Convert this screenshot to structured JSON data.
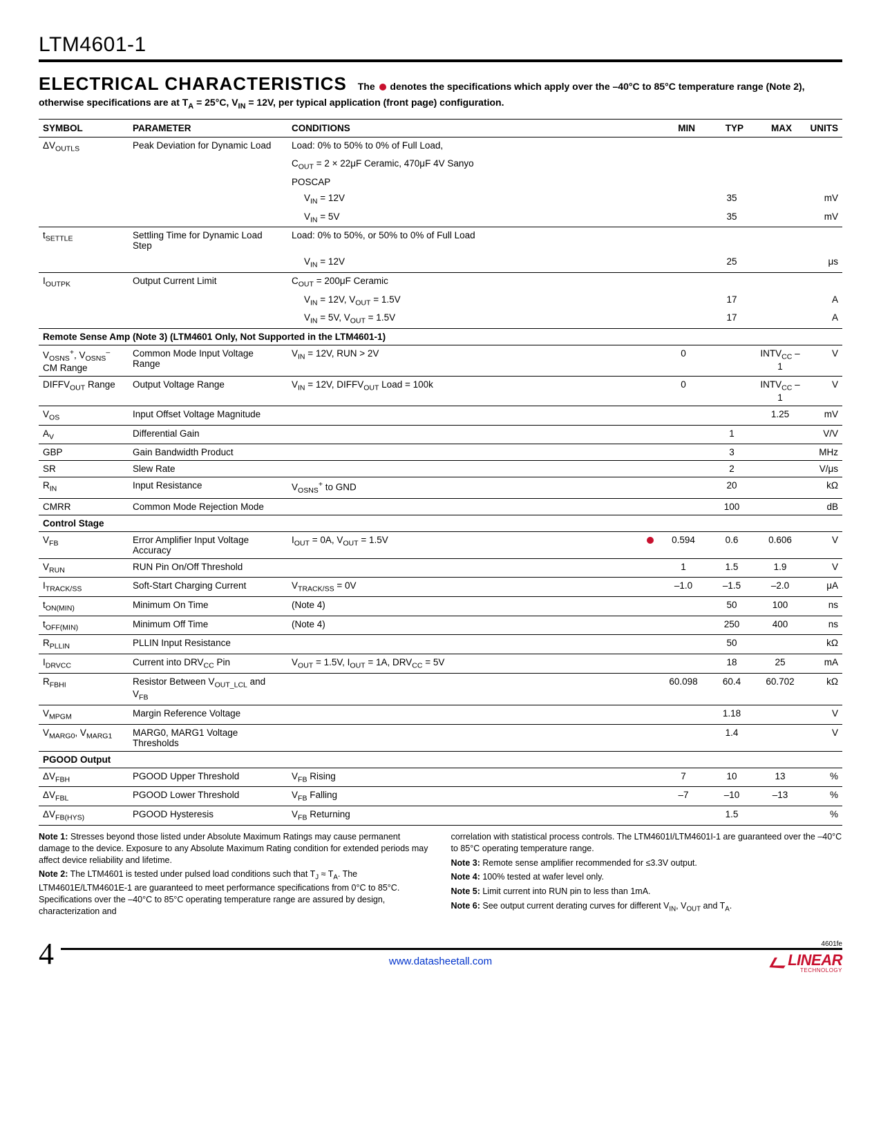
{
  "partNumber": "LTM4601-1",
  "section": {
    "title": "ELECTRICAL CHARACTERISTICS",
    "desc_pre": "The",
    "desc_post": "denotes the specifications which apply over the –40°C to 85°C temperature range (Note 2), otherwise specifications are at T",
    "desc_sub": "A",
    "desc_post2": " = 25°C, V",
    "desc_sub2": "IN",
    "desc_post3": " = 12V, per typical application (front page) configuration."
  },
  "headers": {
    "symbol": "SYMBOL",
    "parameter": "PARAMETER",
    "conditions": "CONDITIONS",
    "min": "MIN",
    "typ": "TYP",
    "max": "MAX",
    "units": "UNITS"
  },
  "group_remote": "Remote Sense Amp (Note 3) (LTM4601 Only, Not Supported in the LTM4601-1)",
  "group_control": "Control Stage",
  "group_pgood": "PGOOD Output",
  "rows": {
    "voutls": {
      "sym_pre": "ΔV",
      "sym_sub": "OUTLS",
      "param": "Peak Deviation for Dynamic Load",
      "cond_l1": "Load: 0% to 50% to 0% of Full Load,",
      "cond_l2_a": "C",
      "cond_l2_sub": "OUT",
      "cond_l2_b": " = 2 × 22μF Ceramic, 470μF 4V Sanyo",
      "cond_l3": "POSCAP",
      "cond_l4_pre": "V",
      "cond_l4_sub": "IN",
      "cond_l4_post": " = 12V",
      "cond_l5_pre": "V",
      "cond_l5_sub": "IN",
      "cond_l5_post": " = 5V",
      "typ1": "35",
      "typ2": "35",
      "unit": "mV"
    },
    "tsettle": {
      "sym_pre": "t",
      "sym_sub": "SETTLE",
      "param": "Settling Time for Dynamic Load Step",
      "cond_l1": "Load: 0% to 50%, or 50% to 0% of Full Load",
      "cond_l2_pre": "V",
      "cond_l2_sub": "IN",
      "cond_l2_post": " = 12V",
      "typ": "25",
      "unit": "μs"
    },
    "ioutpk": {
      "sym_pre": "I",
      "sym_sub": "OUTPK",
      "param": "Output Current Limit",
      "cond_l1_a": "C",
      "cond_l1_sub": "OUT",
      "cond_l1_b": " = 200μF Ceramic",
      "cond_l2": "V_IN = 12V, V_OUT = 1.5V",
      "cond_l3": "V_IN = 5V, V_OUT = 1.5V",
      "typ1": "17",
      "typ2": "17",
      "unit": "A"
    },
    "vosns": {
      "sym": "V_OSNS+, V_OSNS– CM Range",
      "param": "Common Mode Input Voltage Range",
      "cond": "V_IN = 12V, RUN > 2V",
      "min": "0",
      "max": "INTV_CC – 1",
      "unit": "V"
    },
    "diffvout": {
      "sym_pre": "DIFFV",
      "sym_sub": "OUT",
      "sym_post": " Range",
      "param": "Output Voltage Range",
      "cond": "V_IN = 12V, DIFFV_OUT Load = 100k",
      "min": "0",
      "max": "INTV_CC – 1",
      "unit": "V"
    },
    "vos": {
      "sym_pre": "V",
      "sym_sub": "OS",
      "param": "Input Offset Voltage Magnitude",
      "max": "1.25",
      "unit": "mV"
    },
    "av": {
      "sym_pre": "A",
      "sym_sub": "V",
      "param": "Differential Gain",
      "typ": "1",
      "unit": "V/V"
    },
    "gbp": {
      "sym": "GBP",
      "param": "Gain Bandwidth Product",
      "typ": "3",
      "unit": "MHz"
    },
    "sr": {
      "sym": "SR",
      "param": "Slew Rate",
      "typ": "2",
      "unit": "V/μs"
    },
    "rin": {
      "sym_pre": "R",
      "sym_sub": "IN",
      "param": "Input Resistance",
      "cond": "V_OSNS+ to GND",
      "typ": "20",
      "unit": "kΩ"
    },
    "cmrr": {
      "sym": "CMRR",
      "param": "Common Mode Rejection Mode",
      "typ": "100",
      "unit": "dB"
    },
    "vfb": {
      "sym_pre": "V",
      "sym_sub": "FB",
      "param": "Error Amplifier Input Voltage Accuracy",
      "cond": "I_OUT = 0A, V_OUT = 1.5V",
      "marker": true,
      "min": "0.594",
      "typ": "0.6",
      "max": "0.606",
      "unit": "V"
    },
    "vrun": {
      "sym_pre": "V",
      "sym_sub": "RUN",
      "param": "RUN Pin On/Off Threshold",
      "min": "1",
      "typ": "1.5",
      "max": "1.9",
      "unit": "V"
    },
    "itrack": {
      "sym_pre": "I",
      "sym_sub": "TRACK/SS",
      "param": "Soft-Start Charging Current",
      "cond": "V_TRACK/SS = 0V",
      "min": "–1.0",
      "typ": "–1.5",
      "max": "–2.0",
      "unit": "μA"
    },
    "tonmin": {
      "sym_pre": "t",
      "sym_sub": "ON(MIN)",
      "param": "Minimum On Time",
      "cond": "(Note 4)",
      "typ": "50",
      "max": "100",
      "unit": "ns"
    },
    "toffmin": {
      "sym_pre": "t",
      "sym_sub": "OFF(MIN)",
      "param": "Minimum Off Time",
      "cond": "(Note 4)",
      "typ": "250",
      "max": "400",
      "unit": "ns"
    },
    "rpllin": {
      "sym_pre": "R",
      "sym_sub": "PLLIN",
      "param": "PLLIN Input Resistance",
      "typ": "50",
      "unit": "kΩ"
    },
    "idrvcc": {
      "sym_pre": "I",
      "sym_sub": "DRVCC",
      "param": "Current into DRV_CC Pin",
      "cond": "V_OUT = 1.5V, I_OUT = 1A, DRV_CC = 5V",
      "typ": "18",
      "max": "25",
      "unit": "mA"
    },
    "rfbhi": {
      "sym_pre": "R",
      "sym_sub": "FBHI",
      "param": "Resistor Between V_OUT_LCL and V_FB",
      "min": "60.098",
      "typ": "60.4",
      "max": "60.702",
      "unit": "kΩ"
    },
    "vmpgm": {
      "sym_pre": "V",
      "sym_sub": "MPGM",
      "param": "Margin Reference Voltage",
      "typ": "1.18",
      "unit": "V"
    },
    "vmarg": {
      "sym": "V_MARG0, V_MARG1",
      "param": "MARG0, MARG1 Voltage Thresholds",
      "typ": "1.4",
      "unit": "V"
    },
    "dvfbh": {
      "sym_pre": "ΔV",
      "sym_sub": "FBH",
      "param": "PGOOD Upper Threshold",
      "cond": "V_FB Rising",
      "min": "7",
      "typ": "10",
      "max": "13",
      "unit": "%"
    },
    "dvfbl": {
      "sym_pre": "ΔV",
      "sym_sub": "FBL",
      "param": "PGOOD Lower Threshold",
      "cond": "V_FB Falling",
      "min": "–7",
      "typ": "–10",
      "max": "–13",
      "unit": "%"
    },
    "dvfbhys": {
      "sym_pre": "ΔV",
      "sym_sub": "FB(HYS)",
      "param": "PGOOD Hysteresis",
      "cond": "V_FB Returning",
      "typ": "1.5",
      "unit": "%"
    }
  },
  "notes": {
    "n1_label": "Note 1:",
    "n1": "Stresses beyond those listed under Absolute Maximum Ratings may cause permanent damage to the device. Exposure to any Absolute Maximum Rating condition for extended periods may affect device reliability and lifetime.",
    "n2_label": "Note 2:",
    "n2a": "The LTM4601 is tested under pulsed load conditions such that T",
    "n2a_sub": "J",
    "n2a2": " ≈ T",
    "n2a2_sub": "A",
    "n2b": ". The LTM4601E/LTM4601E-1 are guaranteed to meet performance specifications from 0°C to 85°C. Specifications over the –40°C to 85°C operating temperature range are assured by design, characterization and",
    "n2c": "correlation with statistical process controls. The LTM4601I/LTM4601I-1 are guaranteed over the –40°C to 85°C operating temperature range.",
    "n3_label": "Note 3:",
    "n3": "Remote sense amplifier recommended for ≤3.3V output.",
    "n4_label": "Note 4:",
    "n4": "100% tested at wafer level only.",
    "n5_label": "Note 5:",
    "n5": "Limit current into RUN pin to less than 1mA.",
    "n6_label": "Note 6:",
    "n6": "See output current derating curves for different V",
    "n6_sub1": "IN",
    "n6_2": ", V",
    "n6_sub2": "OUT",
    "n6_3": " and T",
    "n6_sub3": "A",
    "n6_4": "."
  },
  "footer": {
    "rev": "4601fe",
    "page": "4",
    "url": "www.datasheetall.com",
    "logo": "LINEAR",
    "logo_sub": "TECHNOLOGY"
  }
}
